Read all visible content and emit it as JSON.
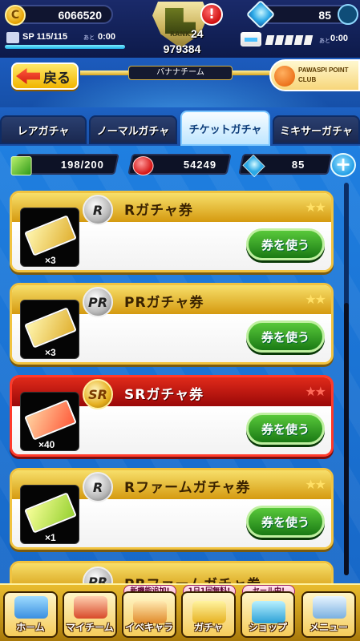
{
  "status": {
    "coins": "6066520",
    "gems": "85",
    "sp": {
      "label": "SP",
      "value": "115/115",
      "ato": "あと",
      "time": "0:00",
      "fill_fraction": 1.0
    },
    "ticket_energy": {
      "ato": "あと",
      "time": "0:00"
    },
    "rank": {
      "label": "RANK",
      "level": "24",
      "score": "979384"
    },
    "alert": "!"
  },
  "header": {
    "back_label": "戻る",
    "team_name": "バナナチーム",
    "pawaspi": "PAWASPI POINT CLUB"
  },
  "tabs": [
    {
      "label": "レアガチャ",
      "active": false
    },
    {
      "label": "ノーマルガチャ",
      "active": false
    },
    {
      "label": "チケットガチャ",
      "active": true
    },
    {
      "label": "ミキサーガチャ",
      "active": false
    }
  ],
  "counters": {
    "cubes": "198/200",
    "red_balls": "54249",
    "gems": "85",
    "plus": "+"
  },
  "tickets": [
    {
      "badge": "R",
      "title": "Rガチャ券",
      "qty": "×3",
      "button": "券を使う",
      "stars": "★★"
    },
    {
      "badge": "PR",
      "title": "PRガチャ券",
      "qty": "×3",
      "button": "券を使う",
      "stars": "★★"
    },
    {
      "badge": "SR",
      "title": "SRガチャ券",
      "qty": "×40",
      "button": "券を使う",
      "stars": "★★"
    },
    {
      "badge": "R",
      "title": "Rファームガチャ券",
      "qty": "×1",
      "button": "券を使う",
      "stars": "★★"
    },
    {
      "badge": "PR",
      "title": "PRファームガチャ券",
      "qty": "",
      "button": "",
      "stars": ""
    }
  ],
  "bottom_nav": [
    {
      "label": "ホーム",
      "flag": ""
    },
    {
      "label": "マイチーム",
      "flag": ""
    },
    {
      "label": "イベキャラ",
      "flag": "新機能追加!"
    },
    {
      "label": "ガチャ",
      "flag": "1日1回無料!"
    },
    {
      "label": "ショップ",
      "flag": "セール中!"
    },
    {
      "label": "メニュー",
      "flag": ""
    }
  ],
  "colors": {
    "gold": "#f1c340",
    "sr_red": "#e02a1a",
    "use_button_green": "#3aa828",
    "background_blue": "#1f7fe0"
  }
}
